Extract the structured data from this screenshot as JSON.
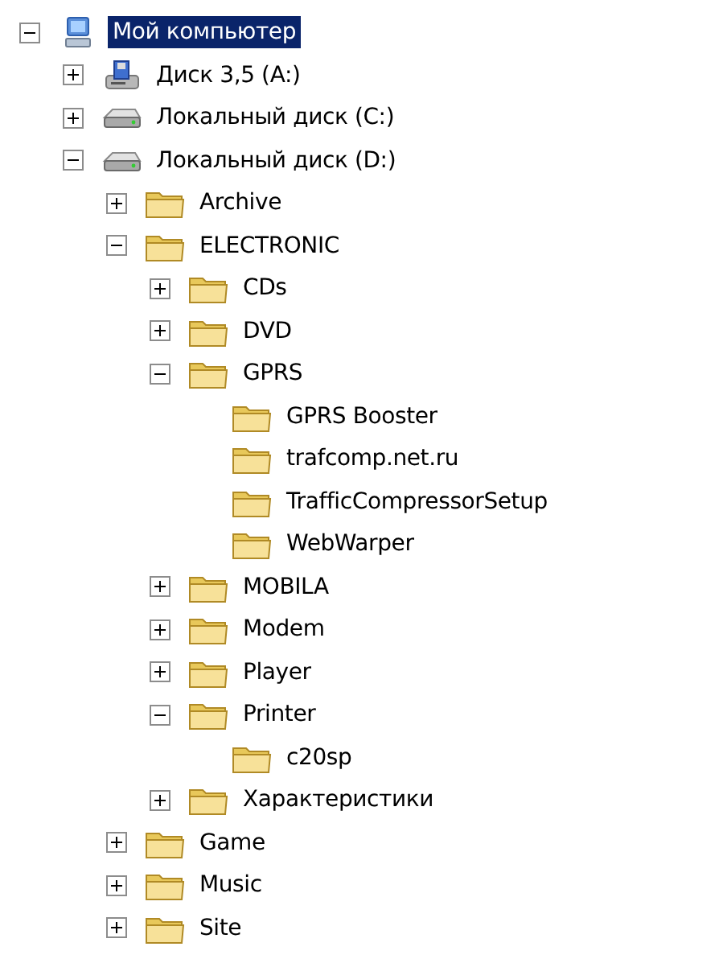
{
  "tree": [
    {
      "label": "Мой компьютер",
      "kind": "computer",
      "expanded": true,
      "selected": true,
      "children": [
        {
          "label": "Диск 3,5 (A:)",
          "kind": "floppy",
          "expanded": false,
          "selected": false
        },
        {
          "label": "Локальный диск (C:)",
          "kind": "drive",
          "expanded": false,
          "selected": false
        },
        {
          "label": "Локальный диск (D:)",
          "kind": "drive",
          "expanded": true,
          "selected": false,
          "children": [
            {
              "label": "Archive",
              "kind": "folder",
              "expanded": false,
              "selected": false
            },
            {
              "label": "ELECTRONIC",
              "kind": "folder",
              "expanded": true,
              "selected": false,
              "children": [
                {
                  "label": "CDs",
                  "kind": "folder",
                  "expanded": false,
                  "selected": false
                },
                {
                  "label": "DVD",
                  "kind": "folder",
                  "expanded": false,
                  "selected": false
                },
                {
                  "label": "GPRS",
                  "kind": "folder",
                  "expanded": true,
                  "selected": false,
                  "children": [
                    {
                      "label": "GPRS Booster",
                      "kind": "folder",
                      "selected": false
                    },
                    {
                      "label": "trafcomp.net.ru",
                      "kind": "folder",
                      "selected": false
                    },
                    {
                      "label": "TrafficCompressorSetup",
                      "kind": "folder",
                      "selected": false
                    },
                    {
                      "label": "WebWarper",
                      "kind": "folder",
                      "selected": false
                    }
                  ]
                },
                {
                  "label": "MOBILA",
                  "kind": "folder",
                  "expanded": false,
                  "selected": false
                },
                {
                  "label": "Modem",
                  "kind": "folder",
                  "expanded": false,
                  "selected": false
                },
                {
                  "label": "Player",
                  "kind": "folder",
                  "expanded": false,
                  "selected": false
                },
                {
                  "label": "Printer",
                  "kind": "folder",
                  "expanded": true,
                  "selected": false,
                  "children": [
                    {
                      "label": "c20sp",
                      "kind": "folder",
                      "selected": false
                    }
                  ]
                },
                {
                  "label": "Характеристики",
                  "kind": "folder",
                  "expanded": false,
                  "selected": false
                }
              ]
            },
            {
              "label": "Game",
              "kind": "folder",
              "expanded": false,
              "selected": false
            },
            {
              "label": "Music",
              "kind": "folder",
              "expanded": false,
              "selected": false
            },
            {
              "label": "Site",
              "kind": "folder",
              "expanded": false,
              "selected": false
            }
          ]
        }
      ]
    }
  ]
}
